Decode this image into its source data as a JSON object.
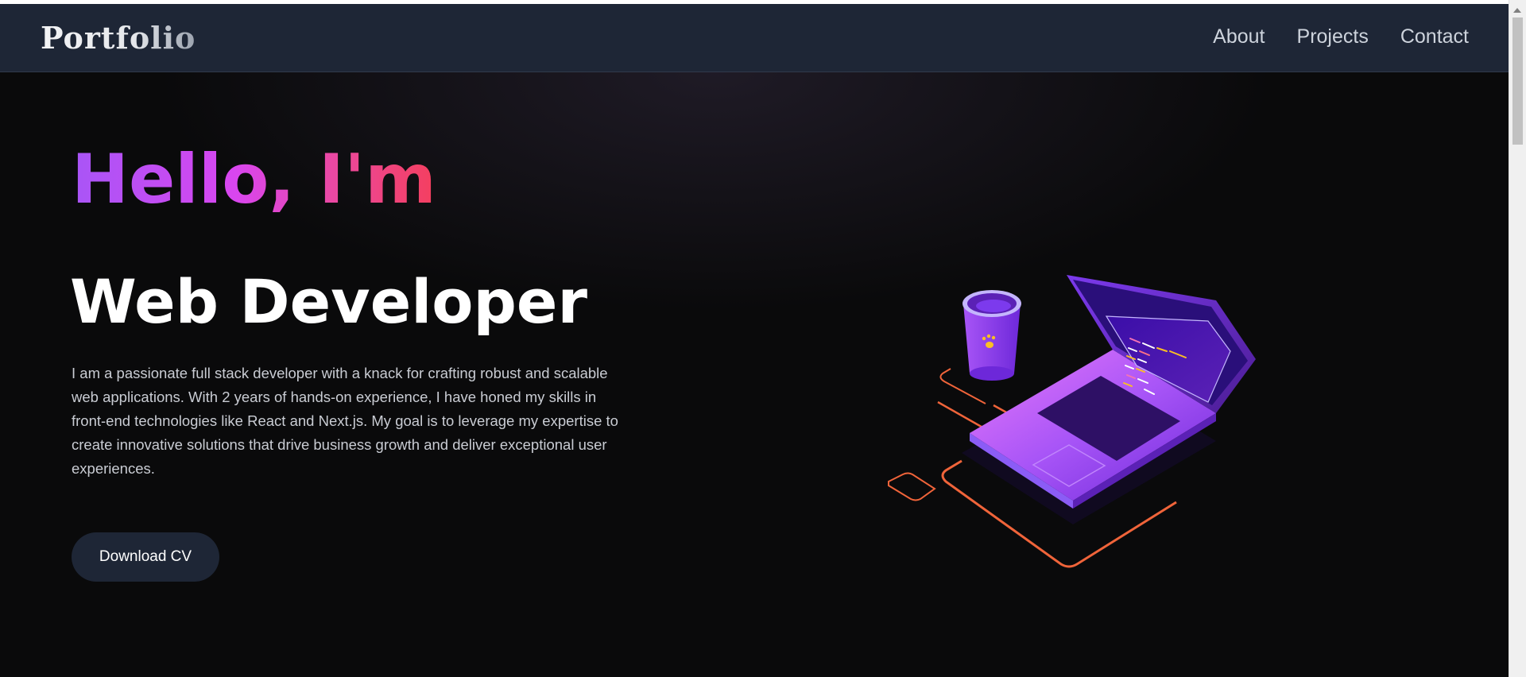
{
  "nav": {
    "logo": "Portfolio",
    "links": [
      "About",
      "Projects",
      "Contact"
    ]
  },
  "hero": {
    "greeting": "Hello, I'm",
    "role": "Web Developer",
    "bio": "I am a passionate full stack developer with a knack for crafting robust and scalable web applications. With 2 years of hands-on experience, I have honed my skills in front-end technologies like React and Next.js. My goal is to leverage my expertise to create innovative solutions that drive business growth and deliver exceptional user experiences.",
    "cta_label": "Download CV",
    "illustration": "laptop-coffee-illustration"
  },
  "colors": {
    "background": "#0a0a0b",
    "navbar": "#1e2636",
    "gradient_start": "#a855f7",
    "gradient_end": "#f43f5e",
    "button": "#1e2636"
  }
}
